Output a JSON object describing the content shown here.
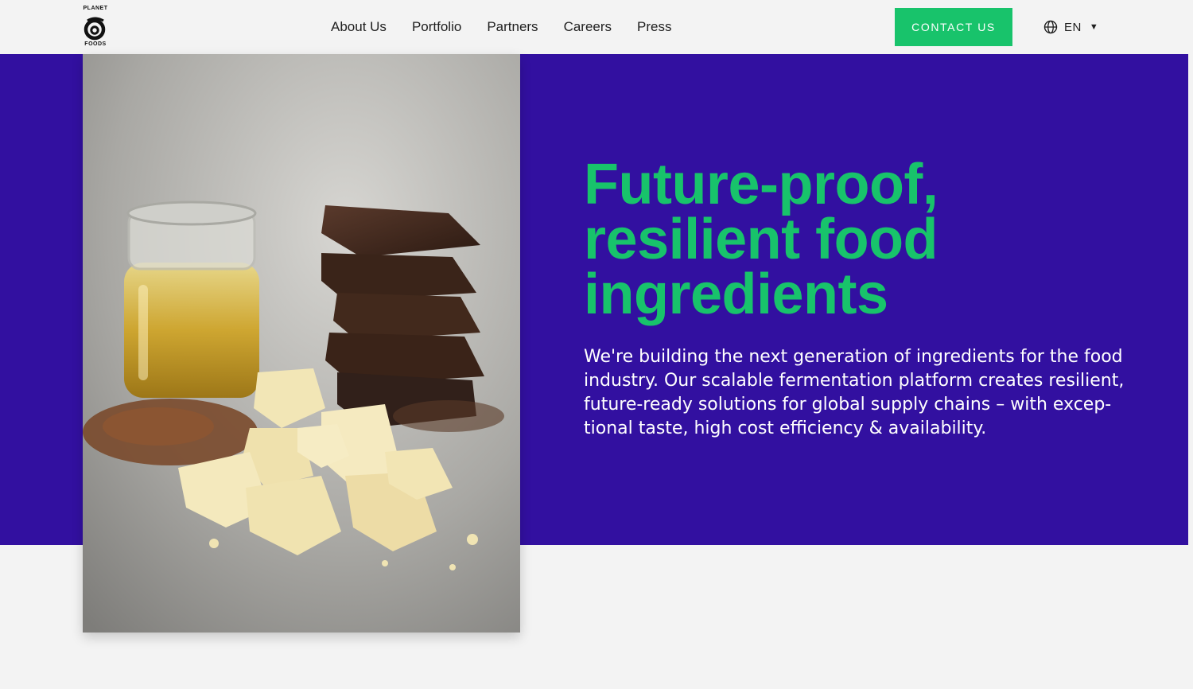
{
  "brand": {
    "logo_top": "PLANET",
    "logo_bottom": "FOODS",
    "logo_icon": "planet-a-logo-icon"
  },
  "nav": {
    "items": [
      {
        "label": "About Us"
      },
      {
        "label": "Portfolio"
      },
      {
        "label": "Partners"
      },
      {
        "label": "Careers"
      },
      {
        "label": "Press"
      }
    ]
  },
  "header": {
    "contact_label": "CONTACT US",
    "language": {
      "label": "EN",
      "icon": "globe-icon",
      "caret_icon": "caret-down-icon"
    }
  },
  "hero": {
    "headline_lines": [
      "Future-proof,",
      "resilient food",
      "ingredients"
    ],
    "lead_lines": [
      "We're building the next generation of ingredients for the food",
      "industry. Our scalable fermentation platform creates resilient,",
      "future-ready solutions for global supply chains – with excep-",
      "tional taste, high cost efficiency & availability."
    ]
  },
  "colors": {
    "accent_green": "#18c36b",
    "hero_purple": "#3210a0",
    "page_background": "#f3f3f3",
    "text_dark": "#1f1f1f"
  }
}
